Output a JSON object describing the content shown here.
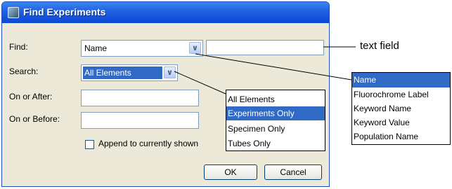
{
  "dialog": {
    "title": "Find Experiments",
    "find_label": "Find:",
    "find_value": "Name",
    "find_text_value": "",
    "search_label": "Search:",
    "search_value": "All Elements",
    "on_or_after_label": "On or After:",
    "on_or_after_value": "",
    "on_or_before_label": "On or Before:",
    "on_or_before_value": "",
    "append_label": "Append to currently shown",
    "append_checked": false,
    "ok_label": "OK",
    "cancel_label": "Cancel"
  },
  "callout": {
    "text": "text field"
  },
  "find_options": [
    "Name",
    "Fluorochrome Label",
    "Keyword Name",
    "Keyword Value",
    "Population Name"
  ],
  "find_selected": "Name",
  "search_options": [
    "All Elements",
    "Experiments Only",
    "Specimen Only",
    "Tubes Only"
  ],
  "search_highlighted": "Experiments Only",
  "colors": {
    "title_bar": "#0b49d3",
    "dialog_bg": "#ece9d8",
    "selection": "#316ac5"
  }
}
